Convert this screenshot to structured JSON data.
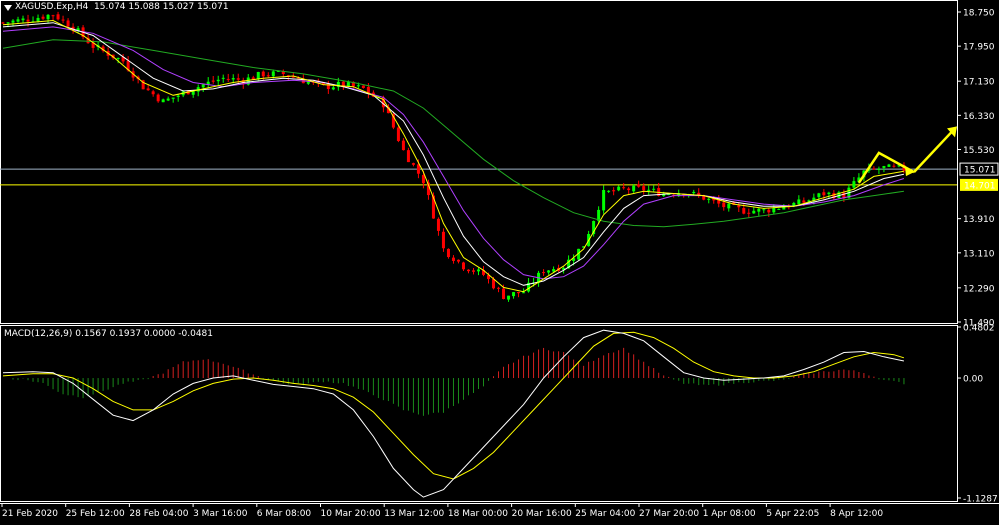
{
  "header": {
    "symbol_line": "XAGUSD.Exp,H4  15.074 15.088 15.027 15.071",
    "macd_line": "MACD(12,26,9) 0.1567 0.1937 0.0000 -0.0481"
  },
  "colors": {
    "background": "#000000",
    "axis": "#ffffff",
    "bull_candle": "#00ff00",
    "bear_candle": "#ff0000",
    "ma_fast": "#ffff00",
    "ma_mid": "#ffffff",
    "ma_slow": "#b040ff",
    "ma_long": "#22aa22",
    "hist_pos": "#d42020",
    "hist_neg": "#1a8a1a",
    "signal": "#ffff00",
    "macd": "#ffffff",
    "support_line": "#ffff00",
    "price_line": "#9fb4c8",
    "arrow": "#ffff00"
  },
  "chart_data": [
    {
      "type": "candlestick",
      "title": "XAGUSD.Exp,H4",
      "ylim": [
        11.49,
        18.75
      ],
      "ytick_labels": [
        "18.750",
        "17.950",
        "17.130",
        "16.330",
        "15.530",
        "14.701",
        "13.910",
        "13.110",
        "12.290",
        "11.490"
      ],
      "ytick_values": [
        18.75,
        17.95,
        17.13,
        16.33,
        15.53,
        14.701,
        13.91,
        13.11,
        12.29,
        11.49
      ],
      "x_labels": [
        "21 Feb 2020",
        "25 Feb 12:00",
        "28 Feb 04:00",
        "3 Mar 16:00",
        "6 Mar 08:00",
        "10 Mar 20:00",
        "13 Mar 12:00",
        "18 Mar 00:00",
        "20 Mar 16:00",
        "25 Mar 04:00",
        "27 Mar 20:00",
        "1 Apr 08:00",
        "5 Apr 22:05",
        "8 Apr 12:00"
      ],
      "current_price": 15.071,
      "current_price_label": "15.071",
      "support_level": 14.701,
      "support_label": "14.701",
      "close_path": [
        [
          0,
          18.5
        ],
        [
          6,
          18.6
        ],
        [
          10,
          18.7
        ],
        [
          14,
          18.4
        ],
        [
          18,
          17.95
        ],
        [
          24,
          17.6
        ],
        [
          28,
          17.0
        ],
        [
          32,
          16.65
        ],
        [
          36,
          16.85
        ],
        [
          40,
          17.05
        ],
        [
          44,
          17.2
        ],
        [
          48,
          17.15
        ],
        [
          52,
          17.3
        ],
        [
          56,
          17.3
        ],
        [
          60,
          17.15
        ],
        [
          64,
          17.0
        ],
        [
          68,
          17.05
        ],
        [
          72,
          16.95
        ],
        [
          76,
          16.6
        ],
        [
          80,
          15.5
        ],
        [
          84,
          14.8
        ],
        [
          88,
          13.2
        ],
        [
          92,
          12.8
        ],
        [
          96,
          12.6
        ],
        [
          100,
          12.1
        ],
        [
          104,
          12.2
        ],
        [
          108,
          12.7
        ],
        [
          112,
          12.8
        ],
        [
          116,
          13.3
        ],
        [
          120,
          14.5
        ],
        [
          124,
          14.6
        ],
        [
          128,
          14.6
        ],
        [
          132,
          14.5
        ],
        [
          136,
          14.55
        ],
        [
          140,
          14.4
        ],
        [
          144,
          14.2
        ],
        [
          148,
          14.1
        ],
        [
          152,
          14.1
        ],
        [
          156,
          14.2
        ],
        [
          160,
          14.3
        ],
        [
          164,
          14.5
        ],
        [
          168,
          14.45
        ],
        [
          172,
          15.0
        ],
        [
          176,
          15.1
        ],
        [
          180,
          15.07
        ]
      ],
      "ma_fast": [
        [
          0,
          18.45
        ],
        [
          10,
          18.55
        ],
        [
          16,
          18.2
        ],
        [
          22,
          17.7
        ],
        [
          28,
          17.1
        ],
        [
          34,
          16.8
        ],
        [
          40,
          16.95
        ],
        [
          46,
          17.1
        ],
        [
          52,
          17.2
        ],
        [
          58,
          17.25
        ],
        [
          64,
          17.05
        ],
        [
          70,
          17.0
        ],
        [
          76,
          16.7
        ],
        [
          80,
          15.9
        ],
        [
          84,
          15.0
        ],
        [
          88,
          13.8
        ],
        [
          92,
          13.0
        ],
        [
          96,
          12.7
        ],
        [
          100,
          12.3
        ],
        [
          104,
          12.2
        ],
        [
          108,
          12.5
        ],
        [
          112,
          12.8
        ],
        [
          116,
          13.2
        ],
        [
          120,
          14.0
        ],
        [
          124,
          14.45
        ],
        [
          128,
          14.55
        ],
        [
          134,
          14.5
        ],
        [
          140,
          14.45
        ],
        [
          146,
          14.25
        ],
        [
          152,
          14.15
        ],
        [
          158,
          14.2
        ],
        [
          164,
          14.4
        ],
        [
          170,
          14.6
        ],
        [
          174,
          14.9
        ],
        [
          180,
          15.02
        ]
      ],
      "ma_mid": [
        [
          0,
          18.4
        ],
        [
          10,
          18.5
        ],
        [
          18,
          18.2
        ],
        [
          24,
          17.7
        ],
        [
          30,
          17.2
        ],
        [
          36,
          16.9
        ],
        [
          42,
          16.95
        ],
        [
          48,
          17.1
        ],
        [
          56,
          17.2
        ],
        [
          62,
          17.15
        ],
        [
          68,
          17.0
        ],
        [
          74,
          16.8
        ],
        [
          80,
          16.2
        ],
        [
          84,
          15.4
        ],
        [
          88,
          14.4
        ],
        [
          92,
          13.5
        ],
        [
          96,
          12.9
        ],
        [
          100,
          12.55
        ],
        [
          104,
          12.35
        ],
        [
          108,
          12.45
        ],
        [
          112,
          12.7
        ],
        [
          116,
          13.0
        ],
        [
          120,
          13.6
        ],
        [
          124,
          14.15
        ],
        [
          128,
          14.45
        ],
        [
          134,
          14.5
        ],
        [
          140,
          14.45
        ],
        [
          146,
          14.3
        ],
        [
          152,
          14.2
        ],
        [
          158,
          14.2
        ],
        [
          164,
          14.35
        ],
        [
          170,
          14.55
        ],
        [
          176,
          14.85
        ],
        [
          180,
          14.95
        ]
      ],
      "ma_slow": [
        [
          0,
          18.3
        ],
        [
          10,
          18.4
        ],
        [
          18,
          18.25
        ],
        [
          26,
          17.85
        ],
        [
          32,
          17.4
        ],
        [
          38,
          17.1
        ],
        [
          44,
          17.0
        ],
        [
          50,
          17.1
        ],
        [
          58,
          17.15
        ],
        [
          64,
          17.1
        ],
        [
          70,
          16.95
        ],
        [
          76,
          16.75
        ],
        [
          80,
          16.35
        ],
        [
          84,
          15.7
        ],
        [
          88,
          14.9
        ],
        [
          92,
          14.1
        ],
        [
          96,
          13.45
        ],
        [
          100,
          12.95
        ],
        [
          104,
          12.6
        ],
        [
          108,
          12.5
        ],
        [
          112,
          12.55
        ],
        [
          116,
          12.8
        ],
        [
          120,
          13.3
        ],
        [
          124,
          13.85
        ],
        [
          128,
          14.25
        ],
        [
          134,
          14.45
        ],
        [
          140,
          14.45
        ],
        [
          146,
          14.35
        ],
        [
          152,
          14.25
        ],
        [
          158,
          14.2
        ],
        [
          164,
          14.3
        ],
        [
          170,
          14.45
        ],
        [
          176,
          14.7
        ],
        [
          180,
          14.85
        ]
      ],
      "ma_long": [
        [
          0,
          17.9
        ],
        [
          10,
          18.1
        ],
        [
          20,
          18.05
        ],
        [
          30,
          17.85
        ],
        [
          40,
          17.65
        ],
        [
          50,
          17.45
        ],
        [
          60,
          17.3
        ],
        [
          70,
          17.1
        ],
        [
          78,
          16.9
        ],
        [
          84,
          16.5
        ],
        [
          90,
          15.9
        ],
        [
          96,
          15.3
        ],
        [
          102,
          14.8
        ],
        [
          108,
          14.4
        ],
        [
          114,
          14.05
        ],
        [
          120,
          13.85
        ],
        [
          126,
          13.75
        ],
        [
          132,
          13.72
        ],
        [
          138,
          13.78
        ],
        [
          144,
          13.85
        ],
        [
          150,
          13.95
        ],
        [
          156,
          14.05
        ],
        [
          162,
          14.2
        ],
        [
          168,
          14.35
        ],
        [
          174,
          14.45
        ],
        [
          180,
          14.55
        ]
      ],
      "zigzag": [
        [
          171,
          14.75
        ],
        [
          175,
          15.45
        ],
        [
          182,
          15.0
        ]
      ],
      "projection_arrow": [
        [
          182,
          15.0
        ],
        [
          190,
          16.0
        ]
      ]
    },
    {
      "type": "macd",
      "title": "MACD(12,26,9) 0.1567 0.1937 0.0000 -0.0481",
      "ylim": [
        -1.1287,
        0.4802
      ],
      "ytick_labels": [
        "0.4802",
        "0.00",
        "-1.1287"
      ],
      "ytick_values": [
        0.4802,
        0.0,
        -1.1287
      ],
      "histogram": [
        [
          4,
          -0.01
        ],
        [
          8,
          -0.05
        ],
        [
          12,
          -0.15
        ],
        [
          16,
          -0.18
        ],
        [
          20,
          -0.12
        ],
        [
          24,
          -0.05
        ],
        [
          28,
          -0.02
        ],
        [
          32,
          0.05
        ],
        [
          36,
          0.15
        ],
        [
          40,
          0.18
        ],
        [
          44,
          0.14
        ],
        [
          48,
          0.07
        ],
        [
          52,
          0.0
        ],
        [
          56,
          -0.05
        ],
        [
          60,
          -0.06
        ],
        [
          64,
          -0.03
        ],
        [
          68,
          -0.05
        ],
        [
          72,
          -0.12
        ],
        [
          76,
          -0.2
        ],
        [
          80,
          -0.3
        ],
        [
          84,
          -0.35
        ],
        [
          88,
          -0.32
        ],
        [
          92,
          -0.2
        ],
        [
          96,
          -0.08
        ],
        [
          100,
          0.1
        ],
        [
          104,
          0.2
        ],
        [
          108,
          0.28
        ],
        [
          112,
          0.24
        ],
        [
          116,
          0.12
        ],
        [
          120,
          0.22
        ],
        [
          124,
          0.28
        ],
        [
          128,
          0.15
        ],
        [
          132,
          0.02
        ],
        [
          136,
          -0.05
        ],
        [
          140,
          -0.07
        ],
        [
          144,
          -0.06
        ],
        [
          148,
          -0.04
        ],
        [
          152,
          -0.03
        ],
        [
          156,
          -0.02
        ],
        [
          160,
          0.04
        ],
        [
          164,
          0.06
        ],
        [
          168,
          0.08
        ],
        [
          172,
          0.05
        ],
        [
          176,
          -0.02
        ],
        [
          180,
          -0.05
        ]
      ],
      "macd_line": [
        [
          0,
          0.05
        ],
        [
          6,
          0.06
        ],
        [
          10,
          0.05
        ],
        [
          14,
          -0.05
        ],
        [
          18,
          -0.2
        ],
        [
          22,
          -0.35
        ],
        [
          26,
          -0.4
        ],
        [
          30,
          -0.3
        ],
        [
          34,
          -0.15
        ],
        [
          38,
          -0.05
        ],
        [
          42,
          0.0
        ],
        [
          46,
          0.02
        ],
        [
          50,
          -0.02
        ],
        [
          54,
          -0.06
        ],
        [
          58,
          -0.08
        ],
        [
          62,
          -0.1
        ],
        [
          66,
          -0.15
        ],
        [
          70,
          -0.3
        ],
        [
          74,
          -0.55
        ],
        [
          78,
          -0.85
        ],
        [
          82,
          -1.05
        ],
        [
          84,
          -1.12
        ],
        [
          88,
          -1.05
        ],
        [
          92,
          -0.85
        ],
        [
          96,
          -0.65
        ],
        [
          100,
          -0.45
        ],
        [
          104,
          -0.25
        ],
        [
          108,
          0.0
        ],
        [
          112,
          0.2
        ],
        [
          116,
          0.38
        ],
        [
          120,
          0.45
        ],
        [
          124,
          0.42
        ],
        [
          128,
          0.35
        ],
        [
          132,
          0.2
        ],
        [
          136,
          0.05
        ],
        [
          140,
          0.0
        ],
        [
          144,
          -0.02
        ],
        [
          148,
          -0.01
        ],
        [
          152,
          0.0
        ],
        [
          156,
          0.02
        ],
        [
          160,
          0.08
        ],
        [
          164,
          0.15
        ],
        [
          168,
          0.24
        ],
        [
          172,
          0.25
        ],
        [
          176,
          0.2
        ],
        [
          180,
          0.16
        ]
      ],
      "signal_line": [
        [
          0,
          0.02
        ],
        [
          6,
          0.04
        ],
        [
          10,
          0.04
        ],
        [
          14,
          0.0
        ],
        [
          18,
          -0.1
        ],
        [
          22,
          -0.22
        ],
        [
          26,
          -0.3
        ],
        [
          30,
          -0.3
        ],
        [
          34,
          -0.22
        ],
        [
          38,
          -0.12
        ],
        [
          42,
          -0.05
        ],
        [
          46,
          -0.01
        ],
        [
          50,
          0.0
        ],
        [
          54,
          -0.02
        ],
        [
          58,
          -0.05
        ],
        [
          62,
          -0.07
        ],
        [
          66,
          -0.1
        ],
        [
          70,
          -0.18
        ],
        [
          74,
          -0.32
        ],
        [
          78,
          -0.52
        ],
        [
          82,
          -0.72
        ],
        [
          86,
          -0.9
        ],
        [
          90,
          -0.95
        ],
        [
          94,
          -0.85
        ],
        [
          98,
          -0.7
        ],
        [
          102,
          -0.5
        ],
        [
          106,
          -0.3
        ],
        [
          110,
          -0.1
        ],
        [
          114,
          0.1
        ],
        [
          118,
          0.3
        ],
        [
          122,
          0.42
        ],
        [
          126,
          0.43
        ],
        [
          130,
          0.38
        ],
        [
          134,
          0.28
        ],
        [
          138,
          0.15
        ],
        [
          142,
          0.06
        ],
        [
          146,
          0.02
        ],
        [
          150,
          0.0
        ],
        [
          154,
          0.0
        ],
        [
          158,
          0.02
        ],
        [
          162,
          0.06
        ],
        [
          166,
          0.13
        ],
        [
          170,
          0.2
        ],
        [
          174,
          0.24
        ],
        [
          178,
          0.22
        ],
        [
          180,
          0.19
        ]
      ]
    }
  ]
}
